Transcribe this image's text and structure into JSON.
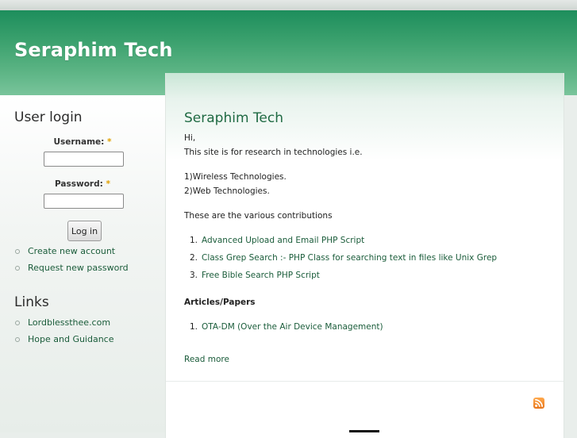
{
  "site": {
    "name": "Seraphim Tech"
  },
  "login": {
    "title": "User login",
    "username_label": "Username:",
    "password_label": "Password:",
    "required_mark": "*",
    "button_label": "Log in",
    "links": [
      "Create new account",
      "Request new password"
    ]
  },
  "links_block": {
    "title": "Links",
    "items": [
      "Lordblessthee.com",
      "Hope and Guidance"
    ]
  },
  "node": {
    "title": "Seraphim Tech",
    "greeting": "Hi,",
    "intro": "This site is for research in technologies i.e.",
    "tech1": "1)Wireless Technologies.",
    "tech2": "2)Web Technologies.",
    "contrib_intro": "These are the various contributions",
    "contributions": [
      {
        "num": "1.",
        "text": "Advanced Upload and Email PHP Script"
      },
      {
        "num": "2.",
        "text": "Class Grep Search :- PHP Class for searching text in files like Unix Grep"
      },
      {
        "num": "3.",
        "text": "Free Bible Search PHP Script"
      }
    ],
    "articles_heading": "Articles/Papers",
    "articles": [
      {
        "num": "1.",
        "text": "OTA-DM (Over the Air Device Management)"
      }
    ],
    "read_more": "Read more"
  },
  "icons": {
    "feed": "rss-feed-icon"
  },
  "colors": {
    "header_green": "#1d8e5c",
    "link": "#1a5c3a",
    "rss": "#f08a24"
  }
}
